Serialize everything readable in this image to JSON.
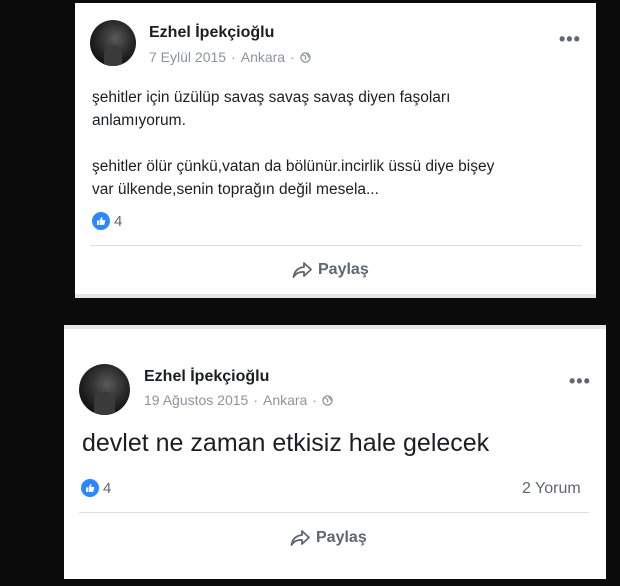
{
  "posts": [
    {
      "author": "Ezhel İpekçioğlu",
      "date": "7 Eylül 2015",
      "location": "Ankara",
      "separator": "·",
      "more_label": "•••",
      "text_lines": [
        "şehitler için üzülüp savaş savaş savaş diyen faşoları anlamıyorum.",
        "şehitler ölür çünkü,vatan da bölünür.incirlik üssü diye bişey var ülkende,senin toprağın değil mesela..."
      ],
      "reaction_count": "4",
      "share_label": "Paylaş"
    },
    {
      "author": "Ezhel İpekçioğlu",
      "date": "19 Ağustos 2015",
      "location": "Ankara",
      "separator": "·",
      "more_label": "•••",
      "text": "devlet ne zaman etkisiz hale gelecek",
      "reaction_count": "4",
      "comments_label": "2 Yorum",
      "share_label": "Paylaş"
    }
  ],
  "colors": {
    "background": "#0b0b0b",
    "card": "#ffffff",
    "like_blue": "#2d88ff",
    "meta_gray": "#8d949e"
  },
  "icons": [
    "avatar",
    "globe-icon",
    "more-icon",
    "like-icon",
    "share-icon"
  ]
}
